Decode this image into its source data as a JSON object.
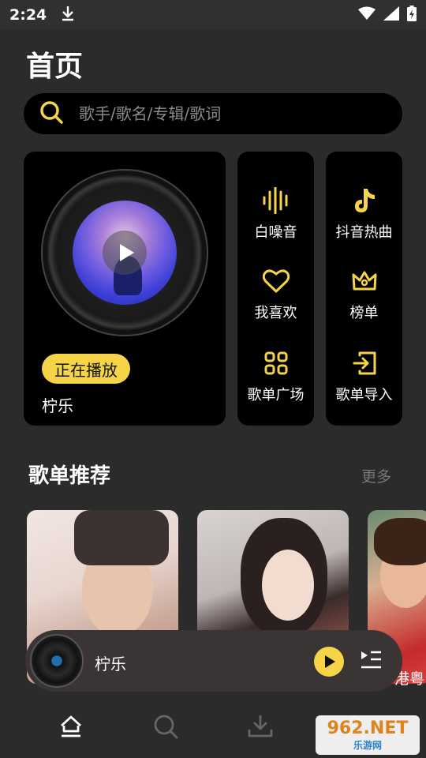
{
  "status_bar": {
    "time": "2:24"
  },
  "page": {
    "title": "首页"
  },
  "search": {
    "placeholder": "歌手/歌名/专辑/歌词"
  },
  "player_card": {
    "badge": "正在播放",
    "song": "柠乐"
  },
  "grid": {
    "items": [
      {
        "label": "白噪音",
        "icon": "waveform-icon"
      },
      {
        "label": "抖音热曲",
        "icon": "tiktok-icon"
      },
      {
        "label": "我喜欢",
        "icon": "heart-icon"
      },
      {
        "label": "榜单",
        "icon": "crown-icon"
      },
      {
        "label": "歌单广场",
        "icon": "grid-icon"
      },
      {
        "label": "歌单导入",
        "icon": "import-icon"
      }
    ]
  },
  "recommend": {
    "title": "歌单推荐",
    "more": "更多",
    "captions": [
      "",
      "",
      "港粤"
    ]
  },
  "mini_player": {
    "title": "柠乐"
  },
  "colors": {
    "accent": "#f5d547",
    "background": "#2b2b2b",
    "card": "#000000"
  },
  "watermark": {
    "logo": "962.NET",
    "sub": "乐游网"
  }
}
